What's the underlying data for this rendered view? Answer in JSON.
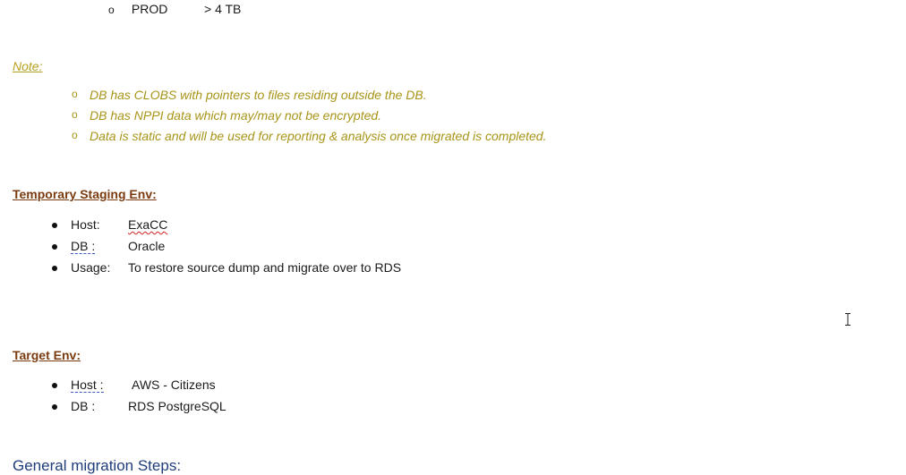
{
  "top_item": {
    "label": "PROD",
    "value": "> 4 TB"
  },
  "note": {
    "heading": "Note:",
    "items": [
      "DB has CLOBS with pointers to files residing outside the DB.",
      "DB has NPPI data which may/may not be encrypted.",
      "Data is static and will be used for reporting & analysis once migrated is completed."
    ]
  },
  "staging": {
    "heading": "Temporary Staging Env:",
    "items": [
      {
        "label": "Host:",
        "value": "ExaCC"
      },
      {
        "label": "DB :",
        "value": "Oracle"
      },
      {
        "label": "Usage:",
        "value": "To restore source dump and migrate over to RDS"
      }
    ]
  },
  "target": {
    "heading": "Target Env:",
    "items": [
      {
        "label": "Host :",
        "value": "AWS - Citizens"
      },
      {
        "label": "DB :",
        "value": "RDS PostgreSQL"
      }
    ]
  },
  "general": {
    "heading": "General migration Steps:"
  },
  "colors": {
    "note_text": "#a89418",
    "heading_brown": "#7a3b10",
    "general_blue": "#1f3d7a"
  },
  "icons": {
    "bullet_open": "circle-outline",
    "bullet_filled": "disc",
    "cursor": "text-cursor-icon"
  }
}
